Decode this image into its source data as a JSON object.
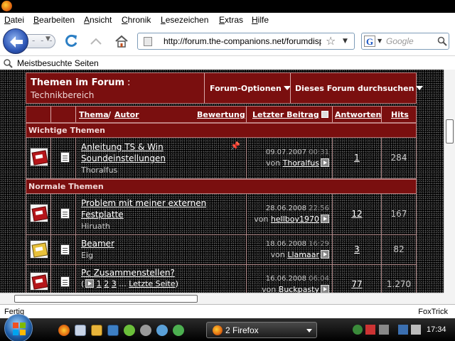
{
  "browser": {
    "menu": [
      "Datei",
      "Bearbeiten",
      "Ansicht",
      "Chronik",
      "Lesezeichen",
      "Extras",
      "Hilfe"
    ],
    "url": "http://forum.the-companions.net/forumdisplay.php",
    "search_placeholder": "Google",
    "search_engine_letter": "G",
    "forward_placeholder": "- - -",
    "bookmark_label": "Meistbesuchte Seiten",
    "status_left": "Fertig",
    "status_right": "FoxTrick"
  },
  "forum": {
    "title": "Themen im Forum",
    "title_colon": ":",
    "subforum": "Technikbereich",
    "options_label": "Forum-Optionen",
    "search_label": "Dieses Forum durchsuchen",
    "columns": {
      "theme": "Thema",
      "slash": "/",
      "author": "Autor",
      "rating": "Bewertung",
      "last_post": "Letzter Beitrag",
      "replies": "Antworten",
      "hits": "Hits"
    },
    "sections": {
      "important": "Wichtige Themen",
      "normal": "Normale Themen"
    },
    "threads": [
      {
        "title_line1": "Anleitung TS & Win",
        "title_line2": "Soundeinstellungen",
        "author": "Thoralfus",
        "date": "09.07.2007",
        "time": "00:31",
        "by_prefix": "von",
        "user": "Thoralfus",
        "replies": "1",
        "hits": "284"
      },
      {
        "title_line1": "Problem mit meiner externen",
        "title_line2": "Festplatte",
        "author": "Hiruath",
        "date": "28.06.2008",
        "time": "22:56",
        "by_prefix": "von",
        "user": "hellboy1970",
        "replies": "12",
        "hits": "167"
      },
      {
        "title_line1": "Beamer",
        "title_line2": "",
        "author": "Eig",
        "date": "18.06.2008",
        "time": "16:29",
        "by_prefix": "von",
        "user": "Llamaar",
        "replies": "3",
        "hits": "82"
      },
      {
        "title_line1": "Pc Zusammenstellen?",
        "pages_open": "(",
        "page1": "1",
        "page2": "2",
        "page3": "3",
        "pages_dots": "...",
        "pages_last": "Letzte Seite",
        "pages_close": ")",
        "date": "16.06.2008",
        "time": "06:04",
        "by_prefix": "von",
        "user": "Buckpasty",
        "replies": "77",
        "hits": "1.270"
      }
    ]
  },
  "taskbar": {
    "window_label": "2 Firefox",
    "clock": "17:34"
  },
  "colors": {
    "forum_red": "#7a0f0f",
    "accent_blue": "#2c55b5"
  }
}
